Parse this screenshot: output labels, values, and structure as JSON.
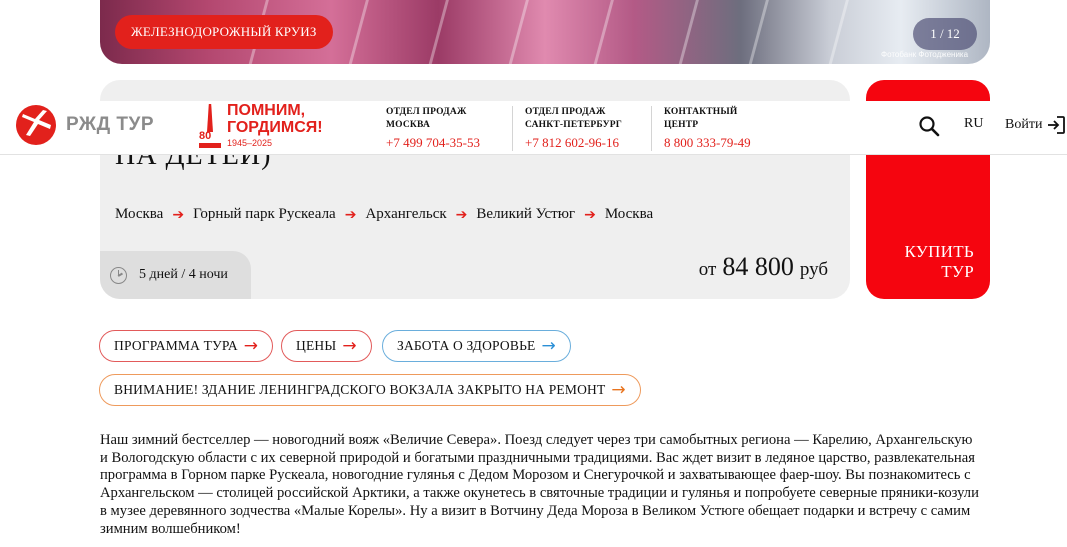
{
  "hero": {
    "badge": "ЖЕЛЕЗНОДОРОЖНЫЙ КРУИЗ",
    "counter": "1 / 12",
    "credit": "Фотобанк Фотодженика"
  },
  "header": {
    "logo_text": "РЖД ТУР",
    "memory": {
      "slogan_line1": "ПОМНИМ,",
      "slogan_line2": "ГОРДИМСЯ!",
      "emblem_number": "80",
      "years": "1945–2025"
    },
    "contacts": [
      {
        "label_line1": "ОТДЕЛ ПРОДАЖ",
        "label_line2": "МОСКВА",
        "phone": "+7 499 704-35-53"
      },
      {
        "label_line1": "ОТДЕЛ ПРОДАЖ",
        "label_line2": "САНКТ-ПЕТЕРБУРГ",
        "phone": "+7 812 602-96-16"
      },
      {
        "label_line1": "КОНТАКТНЫЙ",
        "label_line2": "ЦЕНТР",
        "phone": "8 800 333-79-49"
      }
    ],
    "lang": "RU",
    "login": "Войти"
  },
  "tour": {
    "title_visible": "НА ДЕТЕЙ)",
    "route": [
      "Москва",
      "Горный парк Рускеала",
      "Архангельск",
      "Великий Устюг",
      "Москва"
    ],
    "duration": "5 дней / 4 ночи",
    "price_prefix": "от",
    "price_amount": "84 800",
    "price_currency": "руб",
    "buy_line1": "КУПИТЬ",
    "buy_line2": "ТУР"
  },
  "chips": {
    "program": "ПРОГРАММА ТУРА",
    "prices": "ЦЕНЫ",
    "health": "ЗАБОТА О ЗДОРОВЬЕ",
    "notice": "ВНИМАНИЕ! ЗДАНИЕ ЛЕНИНГРАДСКОГО ВОКЗАЛА ЗАКРЫТО НА РЕМОНТ"
  },
  "description": "Наш зимний бестселлер — новогодний вояж «Величие Севера». Поезд следует через три самобытных региона — Карелию, Архангельскую и Вологодскую области с их северной природой и богатыми праздничными традициями. Вас ждет визит в ледяное царство, развлекательная программа в Горном парке Рускеала, новогодние гулянья с Дедом Морозом и Снегурочкой и захватывающее фаер-шоу. Вы познакомитесь с Архангельском — столицей российской Арктики, а также окунетесь в святочные традиции и гулянья и попробуете северные пряники-козули в музее деревянного зодчества «Малые Корелы». Ну а визит в Вотчину Деда Мороза в Великом Устюге обещает подарки и встречу с самим зимним волшебником!",
  "colors": {
    "accent_red": "#e2211c",
    "buy_red": "#f5050f",
    "card_gray": "#efefef",
    "chip_blue": "#2b8fd6",
    "chip_orange": "#e8741f"
  },
  "icons": {
    "logo": "rzd-logo-icon",
    "search": "search-icon",
    "login": "login-icon",
    "clock": "clock-icon",
    "arrow": "arrow-right-icon"
  }
}
